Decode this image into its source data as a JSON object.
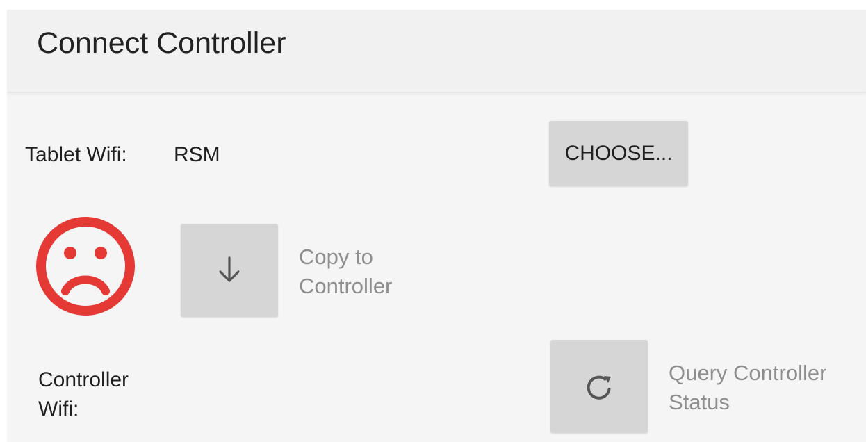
{
  "header": {
    "title": "Connect Controller"
  },
  "tablet_wifi": {
    "label": "Tablet Wifi:",
    "value": "RSM",
    "choose_label": "CHOOSE..."
  },
  "status": {
    "icon": "sad-face-icon",
    "color": "#e53935"
  },
  "actions": {
    "copy_icon": "arrow-down-icon",
    "copy_label": "Copy to Controller",
    "query_icon": "refresh-icon",
    "query_label": "Query Controller Status"
  },
  "controller_wifi": {
    "label": "Controller Wifi:"
  },
  "colors": {
    "header_background": "#f1f1f1",
    "content_background": "#f5f5f5",
    "button_background": "#d6d6d6",
    "text_primary": "#1f1f1f",
    "text_secondary": "#8e8e8e"
  }
}
